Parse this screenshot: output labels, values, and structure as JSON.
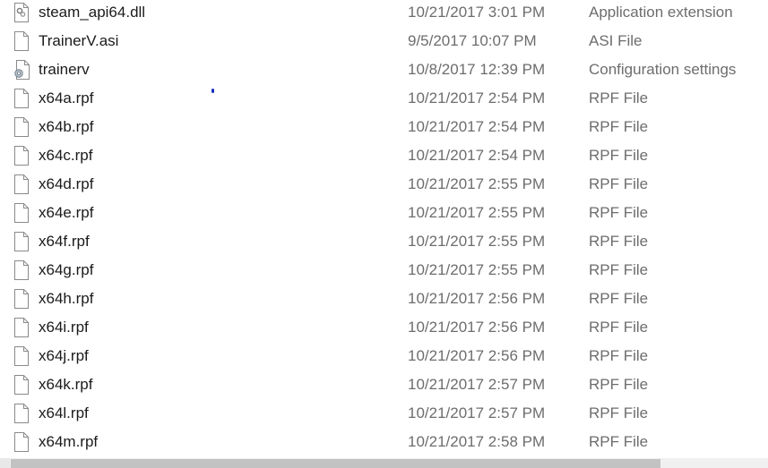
{
  "files": [
    {
      "name": "steam_api64.dll",
      "date": "10/21/2017 3:01 PM",
      "type": "Application extension",
      "icon": "dll-icon"
    },
    {
      "name": "TrainerV.asi",
      "date": "9/5/2017 10:07 PM",
      "type": "ASI File",
      "icon": "file-icon"
    },
    {
      "name": "trainerv",
      "date": "10/8/2017 12:39 PM",
      "type": "Configuration settings",
      "icon": "config-icon"
    },
    {
      "name": "x64a.rpf",
      "date": "10/21/2017 2:54 PM",
      "type": "RPF File",
      "icon": "file-icon"
    },
    {
      "name": "x64b.rpf",
      "date": "10/21/2017 2:54 PM",
      "type": "RPF File",
      "icon": "file-icon"
    },
    {
      "name": "x64c.rpf",
      "date": "10/21/2017 2:54 PM",
      "type": "RPF File",
      "icon": "file-icon"
    },
    {
      "name": "x64d.rpf",
      "date": "10/21/2017 2:55 PM",
      "type": "RPF File",
      "icon": "file-icon"
    },
    {
      "name": "x64e.rpf",
      "date": "10/21/2017 2:55 PM",
      "type": "RPF File",
      "icon": "file-icon"
    },
    {
      "name": "x64f.rpf",
      "date": "10/21/2017 2:55 PM",
      "type": "RPF File",
      "icon": "file-icon"
    },
    {
      "name": "x64g.rpf",
      "date": "10/21/2017 2:55 PM",
      "type": "RPF File",
      "icon": "file-icon"
    },
    {
      "name": "x64h.rpf",
      "date": "10/21/2017 2:56 PM",
      "type": "RPF File",
      "icon": "file-icon"
    },
    {
      "name": "x64i.rpf",
      "date": "10/21/2017 2:56 PM",
      "type": "RPF File",
      "icon": "file-icon"
    },
    {
      "name": "x64j.rpf",
      "date": "10/21/2017 2:56 PM",
      "type": "RPF File",
      "icon": "file-icon"
    },
    {
      "name": "x64k.rpf",
      "date": "10/21/2017 2:57 PM",
      "type": "RPF File",
      "icon": "file-icon"
    },
    {
      "name": "x64l.rpf",
      "date": "10/21/2017 2:57 PM",
      "type": "RPF File",
      "icon": "file-icon"
    },
    {
      "name": "x64m.rpf",
      "date": "10/21/2017 2:58 PM",
      "type": "RPF File",
      "icon": "file-icon"
    }
  ],
  "colors": {
    "name_text": "#1b1b1b",
    "detail_text": "#6d6d6d",
    "scroll_thumb": "#c2c2c2",
    "scroll_track": "#f0f0f0"
  }
}
